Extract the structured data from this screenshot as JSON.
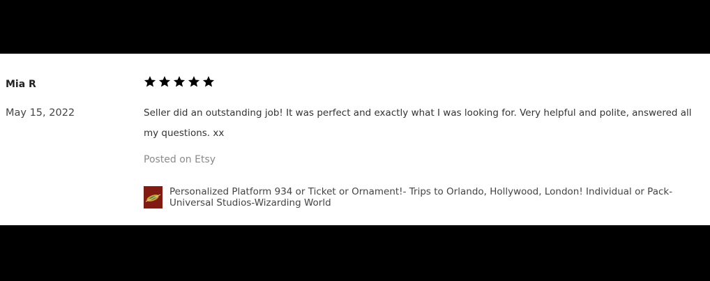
{
  "review": {
    "reviewer_name": "Mia R",
    "date": "May 15, 2022",
    "rating": 5,
    "rating_max": 5,
    "text": "Seller did an outstanding job! It was perfect and exactly what I was looking for. Very helpful and polite, answered all my questions. xx",
    "source": "Posted on Etsy",
    "product": {
      "title": "Personalized Platform 934 or Ticket or Ornament!- Trips to Orlando, Hollywood, London! Individual or Pack- Universal Studios-Wizarding World",
      "thumbnail_icon": "product-thumbnail"
    }
  },
  "colors": {
    "background": "#ffffff",
    "letterbox": "#000000",
    "star": "#000000",
    "muted_text": "#8a8a8a",
    "thumbnail": "#8e1e18"
  }
}
